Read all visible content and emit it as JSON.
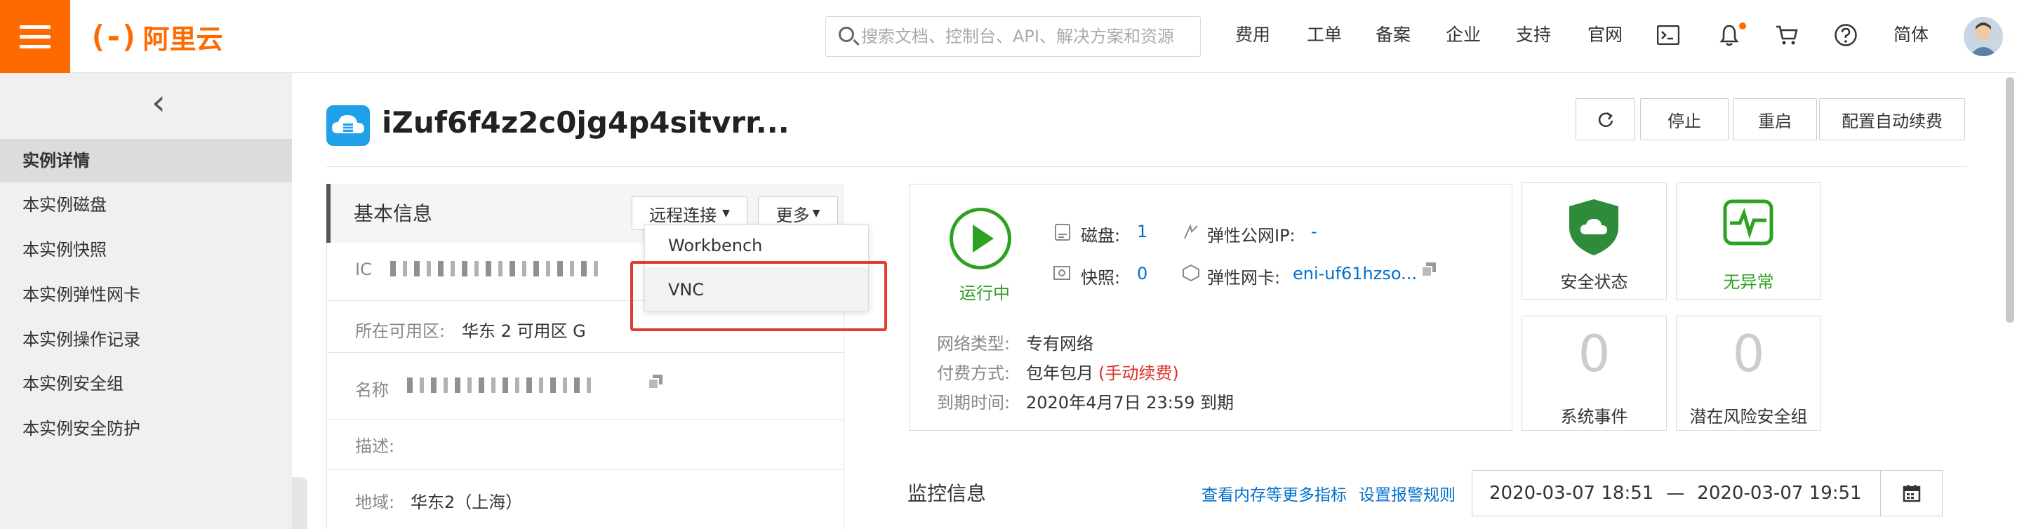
{
  "header": {
    "logo_mark": "(-)",
    "logo_text": "阿里云",
    "search_placeholder": "搜索文档、控制台、API、解决方案和资源",
    "nav": [
      "费用",
      "工单",
      "备案",
      "企业",
      "支持",
      "官网"
    ],
    "language": "简体",
    "icons": [
      "terminal-icon",
      "bell-icon",
      "cart-icon",
      "help-icon"
    ]
  },
  "sidebar": {
    "collapse_glyph": "‹",
    "items": [
      {
        "label": "实例详情",
        "active": true
      },
      {
        "label": "本实例磁盘"
      },
      {
        "label": "本实例快照"
      },
      {
        "label": "本实例弹性网卡"
      },
      {
        "label": "本实例操作记录"
      },
      {
        "label": "本实例安全组"
      },
      {
        "label": "本实例安全防护"
      }
    ]
  },
  "instance": {
    "title": "iZuf6f4z2c0jg4p4sitvrr...",
    "actions": {
      "refresh": "↻",
      "stop": "停止",
      "restart": "重启",
      "auto_renew": "配置自动续费"
    }
  },
  "basic_info": {
    "title": "基本信息",
    "remote_connect": "远程连接",
    "more": "更多",
    "dropdown": {
      "workbench": "Workbench",
      "vnc": "VNC"
    },
    "id_label": "IC",
    "zone_label": "所在可用区:",
    "zone_value": "华东 2 可用区 G",
    "name_label": "名称",
    "desc_label": "描述:",
    "region_label": "地域:",
    "region_value": "华东2（上海）"
  },
  "status": {
    "state": "运行中",
    "disk_label": "磁盘:",
    "disk_value": "1",
    "snapshot_label": "快照:",
    "snapshot_value": "0",
    "eip_label": "弹性公网IP:",
    "eip_value": "-",
    "eni_label": "弹性网卡:",
    "eni_value": "eni-uf61hzso...",
    "network_label": "网络类型:",
    "network_value": "专有网络",
    "billing_label": "付费方式:",
    "billing_value": "包年包月",
    "billing_note": "(手动续费)",
    "expire_label": "到期时间:",
    "expire_value": "2020年4月7日 23:59 到期"
  },
  "cards": {
    "security_state": "安全状态",
    "no_anomaly": "无异常",
    "system_events_count": "0",
    "system_events": "系统事件",
    "risk_sg_count": "0",
    "risk_sg": "潜在风险安全组"
  },
  "monitor": {
    "title": "监控信息",
    "more_metrics": "查看内存等更多指标",
    "alert_rules": "设置报警规则",
    "start": "2020-03-07 18:51",
    "dash": "—",
    "end": "2020-03-07 19:51"
  },
  "colors": {
    "brand": "#ff6a00",
    "green": "#2ea121",
    "link": "#0070cc",
    "highlight": "#e03c2f"
  }
}
